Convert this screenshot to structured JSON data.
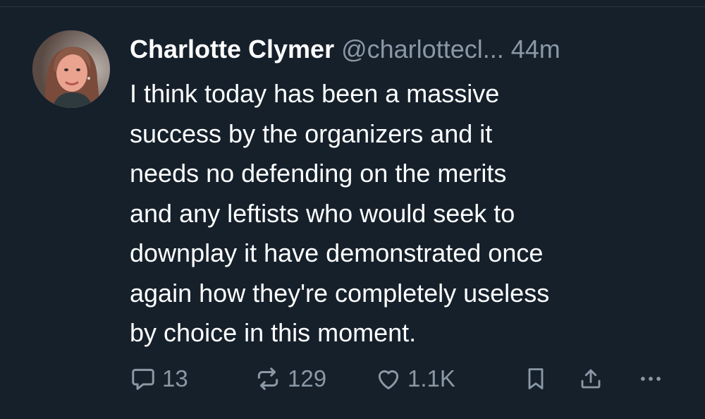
{
  "tweet": {
    "author": {
      "display_name": "Charlotte Clymer",
      "handle": "@charlottecl...",
      "time": "44m"
    },
    "text_lines": [
      "I think today has been a massive",
      "success by the organizers and it",
      "needs no defending on the merits",
      "and any leftists who would seek to",
      "downplay it have demonstrated once",
      "again how they're completely useless",
      "by choice in this moment."
    ],
    "actions": {
      "replies": "13",
      "retweets": "129",
      "likes": "1.1K"
    },
    "icons": {
      "reply": "reply-icon",
      "retweet": "retweet-icon",
      "like": "heart-icon",
      "bookmark": "bookmark-icon",
      "share": "share-icon",
      "more": "more-icon"
    }
  },
  "colors": {
    "background": "#15202b",
    "text_primary": "#ffffff",
    "text_secondary": "#8b98a5"
  }
}
